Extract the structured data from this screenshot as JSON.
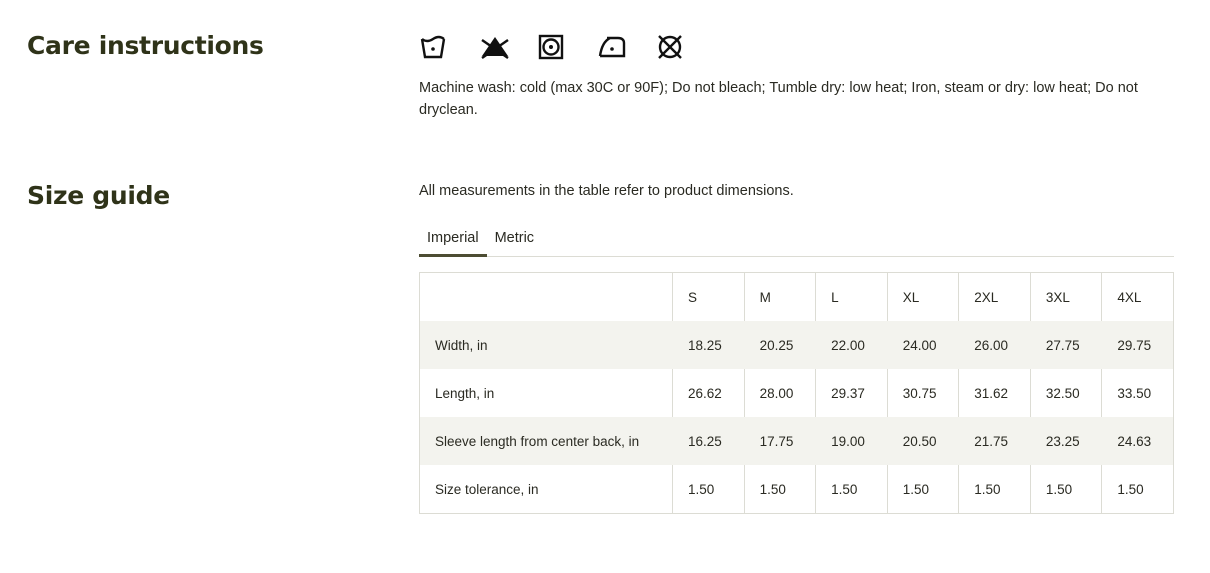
{
  "care": {
    "title": "Care instructions",
    "icons": [
      "wash-cold-icon",
      "do-not-bleach-icon",
      "tumble-dry-low-icon",
      "iron-low-icon",
      "do-not-dryclean-icon"
    ],
    "text": "Machine wash: cold (max 30C or 90F); Do not bleach; Tumble dry: low heat; Iron, steam or dry: low heat; Do not dryclean."
  },
  "size_guide": {
    "title": "Size guide",
    "intro": "All measurements in the table refer to product dimensions.",
    "tabs": [
      {
        "label": "Imperial",
        "active": true
      },
      {
        "label": "Metric",
        "active": false
      }
    ],
    "columns": [
      "",
      "S",
      "M",
      "L",
      "XL",
      "2XL",
      "3XL",
      "4XL"
    ],
    "rows": [
      {
        "label": "Width, in",
        "values": [
          "18.25",
          "20.25",
          "22.00",
          "24.00",
          "26.00",
          "27.75",
          "29.75"
        ]
      },
      {
        "label": "Length, in",
        "values": [
          "26.62",
          "28.00",
          "29.37",
          "30.75",
          "31.62",
          "32.50",
          "33.50"
        ]
      },
      {
        "label": "Sleeve length from center back, in",
        "values": [
          "16.25",
          "17.75",
          "19.00",
          "20.50",
          "21.75",
          "23.25",
          "24.63"
        ]
      },
      {
        "label": "Size tolerance, in",
        "values": [
          "1.50",
          "1.50",
          "1.50",
          "1.50",
          "1.50",
          "1.50",
          "1.50"
        ]
      }
    ]
  },
  "colors": {
    "heading": "#2f3319",
    "tab_active": "#4d4d33",
    "row_shade": "#f3f3ee"
  }
}
